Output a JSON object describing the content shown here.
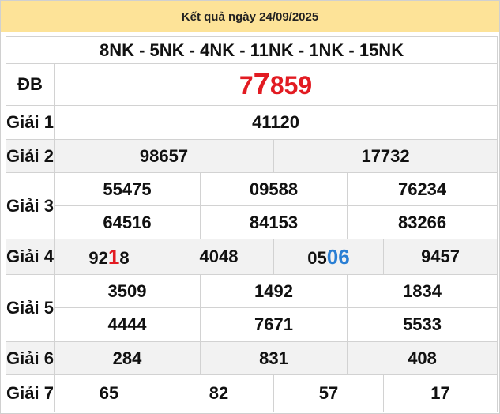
{
  "header": {
    "title": "Kết quả ngày 24/09/2025"
  },
  "provinces": "8NK - 5NK - 4NK - 11NK - 1NK - 15NK",
  "colors": {
    "header_bg": "#fde398",
    "highlight_red": "#e21b22",
    "highlight_blue": "#2a7fd4",
    "province_text": "#1f5fa8"
  },
  "prizes": {
    "db": {
      "label": "ĐB",
      "part1": "7",
      "part2": "7",
      "part3": "859"
    },
    "g1": {
      "label": "Giải 1",
      "values": [
        "41120"
      ]
    },
    "g2": {
      "label": "Giải 2",
      "values": [
        "98657",
        "17732"
      ]
    },
    "g3": {
      "label": "Giải 3",
      "values": [
        "55475",
        "09588",
        "76234",
        "64516",
        "84153",
        "83266"
      ]
    },
    "g4": {
      "label": "Giải 4",
      "v1a": "92",
      "v1b": "1",
      "v1c": "8",
      "v2": "4048",
      "v3a": "05",
      "v3b": "06",
      "v4": "9457"
    },
    "g5": {
      "label": "Giải 5",
      "values": [
        "3509",
        "1492",
        "1834",
        "4444",
        "7671",
        "5533"
      ]
    },
    "g6": {
      "label": "Giải 6",
      "values": [
        "284",
        "831",
        "408"
      ]
    },
    "g7": {
      "label": "Giải 7",
      "values": [
        "65",
        "82",
        "57",
        "17"
      ]
    }
  }
}
